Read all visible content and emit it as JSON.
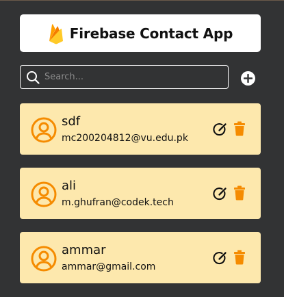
{
  "app": {
    "title": "Firebase Contact App",
    "logo_icon": "firebase-flame-icon"
  },
  "search": {
    "placeholder": "Search...",
    "value": "",
    "icon": "search-icon"
  },
  "add_button": {
    "icon": "plus-icon"
  },
  "contacts": [
    {
      "name": "sdf",
      "email": "mc200204812@vu.edu.pk"
    },
    {
      "name": "ali",
      "email": "m.ghufran@codek.tech"
    },
    {
      "name": "ammar",
      "email": "ammar@gmail.com"
    }
  ],
  "colors": {
    "background": "#323334",
    "card": "#fde8ad",
    "accent": "#f58b00",
    "text": "#111111"
  }
}
